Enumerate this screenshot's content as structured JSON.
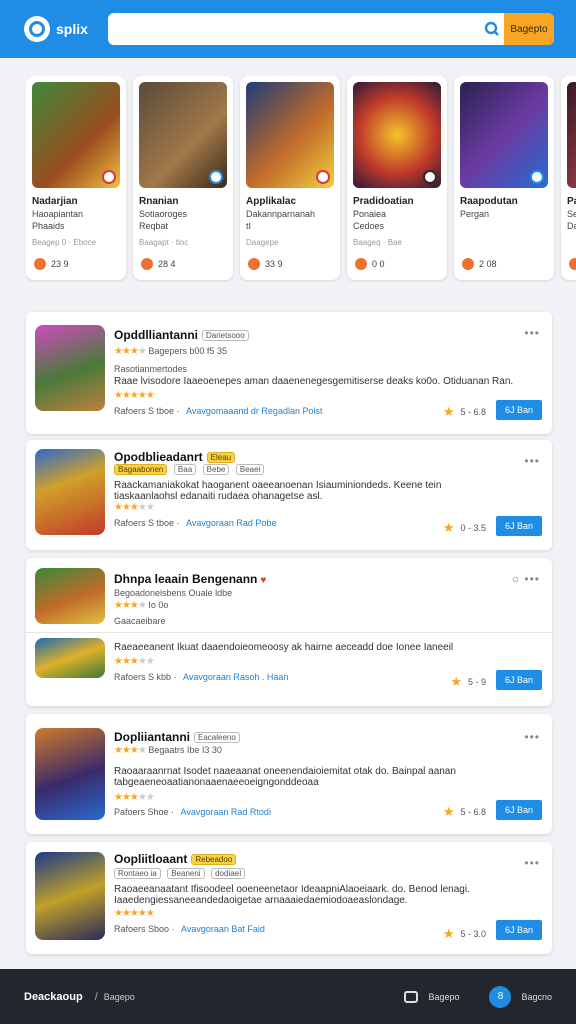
{
  "header": {
    "logo_text": "splix",
    "search_placeholder": "",
    "search_button": "Bagepto"
  },
  "featured": [
    {
      "title": "Nadarjian",
      "subtitle": "Haoapiantan",
      "sub2": "Phaaids",
      "meta": "Beagep 0 · Eboce",
      "count": "23 9"
    },
    {
      "title": "Rnanian",
      "subtitle": "Sotiaoroges",
      "sub2": "Reqbat",
      "meta": "Baagapt · tloc",
      "count": "28 4"
    },
    {
      "title": "Applikalac",
      "subtitle": "Dakannparnanah",
      "sub2": "tI",
      "meta": "Daagepe",
      "count": "33 9"
    },
    {
      "title": "Pradidoatian",
      "subtitle": "Ponaiea",
      "sub2": "Cedoes",
      "meta": "Baageq · Bae",
      "count": "0 0"
    },
    {
      "title": "Raapodutan",
      "subtitle": "Pergan",
      "sub2": "",
      "meta": "",
      "count": "2 08"
    },
    {
      "title": "Pam",
      "subtitle": "Sea",
      "sub2": "Dam",
      "meta": "",
      "count": ""
    }
  ],
  "apps": [
    {
      "name": "Opddlliantanni",
      "tag": "Darietsooo",
      "rating_text": "Bagepers b00 f5 35",
      "subline": "Rasotianmertodes",
      "desc": "Raae lvisodore Iaaeoenepes aman daaenenegesgemitiserse deaks ko0o. Otiduanan Ran.",
      "footer": "Rafoers S tboe",
      "link": "Avavgomaaand dr Regadlan Polst",
      "score": "5 - 6.8",
      "button": "6J Ban",
      "stars": 3,
      "stars2": 5
    },
    {
      "name": "Opodblieadanrt",
      "tag": "Eleau",
      "tags": [
        "Bagaabonen",
        "Baa",
        "Bebe",
        "Beaei"
      ],
      "desc": "Raackamaniakokat haoganent oaeeanoenan Isiauminiondeds. Keene tein tiaskaanlaohsl edanaiti rudaea ohanagetse asl.",
      "footer": "Rafoers S tboe",
      "link": "Avavgoraan Rad Pobe",
      "score": "0 - 3.5",
      "button": "6J Ban",
      "stars": 3
    },
    {
      "name": "Dhnpa leaain Bengenann",
      "rating_text": "Begoadoneisbens Ouale ldbe",
      "rating2": "Io 0o",
      "subline": "Gaacaeibare",
      "desc": "Raeaeeanent Ikuat daaendoieomeoosy ak hairne aeceadd doe Ionee Ianeeil",
      "footer": "Rafoers S kbb",
      "link": "Avavgoraan Rasoh . Haan",
      "score": "5 - 9",
      "button": "6J Ban",
      "stars": 3
    },
    {
      "name": "Dopliiantanni",
      "tag": "Eacaleeno",
      "rating_text": "Begaatrs Ibe I3 30",
      "desc": "Raoaaraanrnat Isodet naaeaanat oneenendaioiemitat otak do. Bainpal aanan tabgeaeneoaatianonaaenaeeoeigngonddeoaa",
      "footer": "Pafoers Shoe",
      "link": "Avavgoraan Rad Rtodi",
      "score": "5 - 6.8",
      "button": "6J Ban",
      "stars": 3,
      "stars2": 3
    },
    {
      "name": "Oopliitloaant",
      "tag": "Rebeadoo",
      "tags": [
        "Rontaeo ia",
        "Beaneni",
        "dodiaeI"
      ],
      "desc": "Raoaeeanaatant Ifisoodeel ooeneenetaor IdeaapniAlaoeiaark. do. Benod lenagi. Iaaedengiessaneeandedaoigetae arnaaaiedaemiodoaeaslondage.",
      "footer": "Rafoers Sboo",
      "link": "Avavgoraan Bat Faid",
      "score": "5 - 3.0",
      "button": "6J Ban",
      "stars": 5
    }
  ],
  "footer": {
    "brand": "Deackaoup",
    "sep": "/",
    "sub": "Bagepo",
    "right1": "Bagepo",
    "right2": "Bagcno",
    "circle": "8"
  }
}
